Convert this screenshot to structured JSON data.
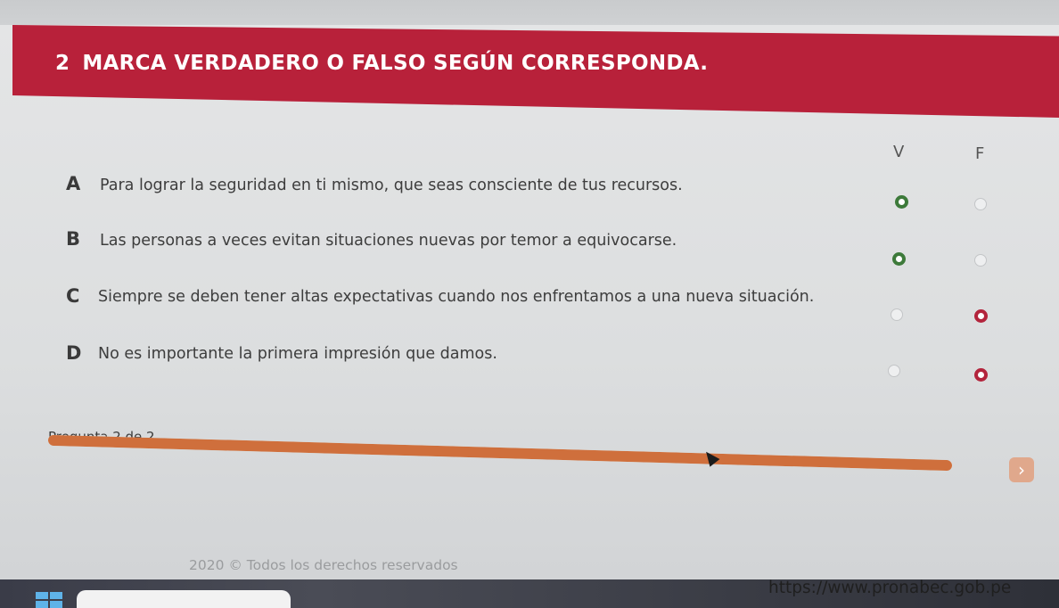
{
  "question": {
    "number": "2",
    "title": "MARCA VERDADERO O FALSO SEGÚN CORRESPONDA."
  },
  "columns": {
    "true_label": "V",
    "false_label": "F"
  },
  "items": [
    {
      "letter": "A",
      "text": "Para lograr la seguridad en ti mismo, que seas consciente de tus recursos.",
      "selected": "V"
    },
    {
      "letter": "B",
      "text": "Las personas a veces evitan situaciones nuevas por temor a equivocarse.",
      "selected": "V"
    },
    {
      "letter": "C",
      "text": "Siempre se deben tener altas expectativas cuando nos enfrentamos a una nueva situación.",
      "selected": "F"
    },
    {
      "letter": "D",
      "text": "No es importante la primera impresión que damos.",
      "selected": "F"
    }
  ],
  "progress": {
    "label": "Pregunta 2 de 2",
    "current": 2,
    "total": 2,
    "fraction": 1.0
  },
  "navigation": {
    "next_symbol": "›"
  },
  "footer": {
    "copyright": "2020 © Todos los derechos reservados",
    "url": "https://www.pronabec.gob.pe"
  },
  "colors": {
    "header": "#b8213a",
    "selected_true": "#3d7a3a",
    "selected_false": "#b3243c",
    "progress_fill": "#cf6f3c"
  },
  "icons": {
    "next": "chevron-right-icon",
    "cursor": "mouse-pointer-icon",
    "windows": "windows-logo-icon"
  }
}
